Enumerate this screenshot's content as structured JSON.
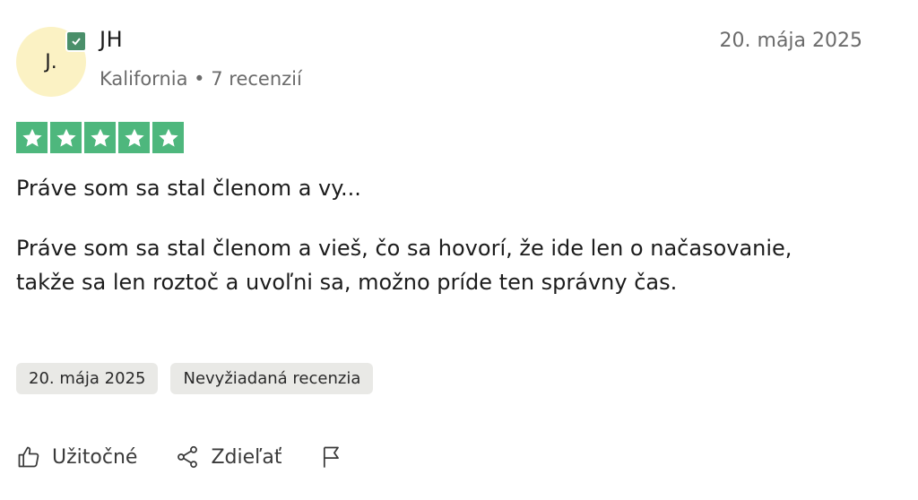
{
  "reviewer": {
    "avatar_initials": "J.",
    "name": "JH",
    "location": "Kalifornia",
    "separator": "•",
    "review_count": "7 recenzií",
    "verified_icon": "check-badge-icon"
  },
  "review": {
    "date": "20. mája 2025",
    "rating": 5,
    "rating_max": 5,
    "star_color": "#4eb77d",
    "title": "Práve som sa stal členom a vy...",
    "body": "Práve som sa stal členom a vieš, čo sa hovorí, že ide len o načasovanie, takže sa len roztoč a uvoľni sa, možno príde ten správny čas.",
    "chips": [
      "20. mája 2025",
      "Nevyžiadaná recenzia"
    ]
  },
  "actions": {
    "useful_label": "Užitočné",
    "share_label": "Zdieľať",
    "useful_icon": "thumbs-up-icon",
    "share_icon": "share-icon",
    "report_icon": "flag-icon"
  }
}
